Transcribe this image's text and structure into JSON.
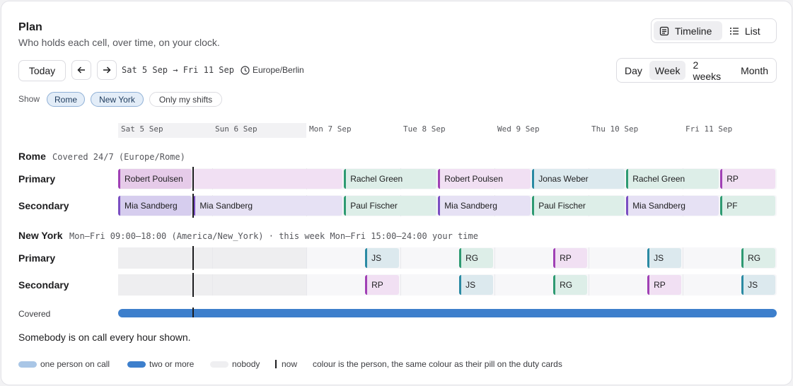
{
  "header": {
    "title": "Plan",
    "subtitle": "Who holds each cell, over time, on your clock."
  },
  "view_toggle": {
    "options": [
      {
        "label": "Timeline",
        "icon": "timeline-icon",
        "active": true
      },
      {
        "label": "List",
        "icon": "list-icon",
        "active": false
      }
    ]
  },
  "nav": {
    "today_label": "Today",
    "prev_icon": "arrow-left-icon",
    "next_icon": "arrow-right-icon",
    "range": "Sat 5 Sep → Fri 11 Sep",
    "timezone": "Europe/Berlin"
  },
  "zoom": {
    "options": [
      {
        "label": "Day",
        "active": false
      },
      {
        "label": "Week",
        "active": true
      },
      {
        "label": "2 weeks",
        "active": false
      },
      {
        "label": "Month",
        "active": false
      }
    ]
  },
  "filters": {
    "label": "Show",
    "chips": [
      {
        "label": "Rome",
        "active": true
      },
      {
        "label": "New York",
        "active": true
      },
      {
        "label": "Only my shifts",
        "active": false
      }
    ]
  },
  "days": [
    "Sat 5 Sep",
    "Sun 6 Sep",
    "Mon 7 Sep",
    "Tue 8 Sep",
    "Wed 9 Sep",
    "Thu 10 Sep",
    "Fri 11 Sep"
  ],
  "groups": [
    {
      "name": "Rome",
      "subtitle": "Covered 24/7 (Europe/Rome)",
      "rows": [
        {
          "label": "Primary",
          "shifts": [
            {
              "person": "Robert Poulsen",
              "start": 0,
              "end": 0.8
            },
            {
              "person": "",
              "start": 0.8,
              "end": 2.4
            },
            {
              "person": "Rachel Green",
              "start": 2.4,
              "end": 3.4
            },
            {
              "person": "Robert Poulsen",
              "start": 3.4,
              "end": 4.4
            },
            {
              "person": "Jonas Weber",
              "start": 4.4,
              "end": 5.4
            },
            {
              "person": "Rachel Green",
              "start": 5.4,
              "end": 6.4
            },
            {
              "person": "RP",
              "start": 6.4,
              "end": 7.0
            }
          ]
        },
        {
          "label": "Secondary",
          "shifts": [
            {
              "person": "Mia Sandberg",
              "start": 0,
              "end": 0.8
            },
            {
              "person": "Mia Sandberg",
              "start": 0.8,
              "end": 2.4
            },
            {
              "person": "Paul Fischer",
              "start": 2.4,
              "end": 3.4
            },
            {
              "person": "Mia Sandberg",
              "start": 3.4,
              "end": 4.4
            },
            {
              "person": "Paul Fischer",
              "start": 4.4,
              "end": 5.4
            },
            {
              "person": "Mia Sandberg",
              "start": 5.4,
              "end": 6.4
            },
            {
              "person": "PF",
              "start": 6.4,
              "end": 7.0
            }
          ]
        }
      ]
    },
    {
      "name": "New York",
      "subtitle": "Mon–Fri 09:00–18:00 (America/New_York) · this week Mon–Fri 15:00–24:00 your time",
      "rows": [
        {
          "label": "Primary",
          "shifts": [
            {
              "person": "JS",
              "start": 2.625,
              "end": 3.0
            },
            {
              "person": "RG",
              "start": 3.625,
              "end": 4.0
            },
            {
              "person": "RP",
              "start": 4.625,
              "end": 5.0
            },
            {
              "person": "JS",
              "start": 5.625,
              "end": 6.0
            },
            {
              "person": "RG",
              "start": 6.625,
              "end": 7.0
            }
          ]
        },
        {
          "label": "Secondary",
          "shifts": [
            {
              "person": "RP",
              "start": 2.625,
              "end": 3.0
            },
            {
              "person": "JS",
              "start": 3.625,
              "end": 4.0
            },
            {
              "person": "RG",
              "start": 4.625,
              "end": 5.0
            },
            {
              "person": "RP",
              "start": 5.625,
              "end": 6.0
            },
            {
              "person": "JS",
              "start": 6.625,
              "end": 7.0
            }
          ]
        }
      ]
    }
  ],
  "coverage": {
    "label": "Covered",
    "statement": "Somebody is on call every hour shown."
  },
  "legend": {
    "items": [
      {
        "label": "one person on call",
        "color": "#a9c6e6"
      },
      {
        "label": "two or more",
        "color": "#3d7fcc"
      },
      {
        "label": "nobody",
        "color": "#efeff1"
      },
      {
        "label": "now",
        "color": "#1d1d1f"
      }
    ],
    "note": "colour is the person, the same colour as their pill on the duty cards"
  },
  "colors": {
    "Robert Poulsen": "#a040b5",
    "RP": "#a040b5",
    "Rachel Green": "#2e9a72",
    "RG": "#2e9a72",
    "Jonas Weber": "#2a8aa3",
    "JS": "#2a8aa3",
    "Mia Sandberg": "#7a4ec2",
    "Paul Fischer": "#2e9a72",
    "PF": "#2e9a72"
  }
}
